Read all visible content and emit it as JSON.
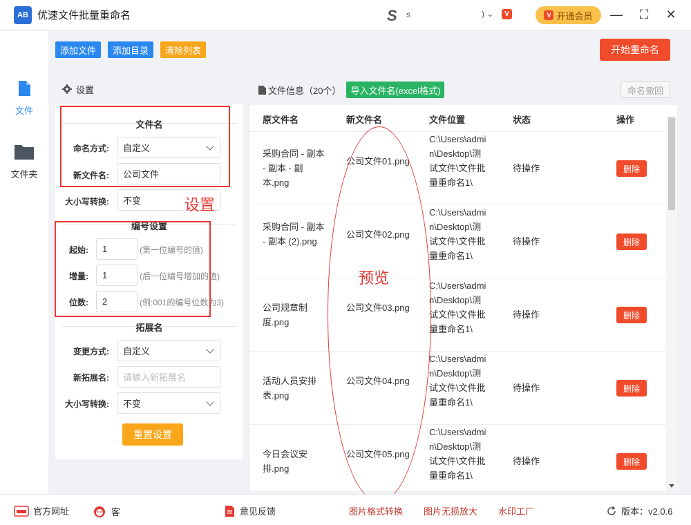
{
  "titlebar": {
    "app_title": "优速文件批量重命名",
    "logo_text": "AB",
    "user_s": "S",
    "user_name": "s",
    "user_arrow": ") ⌄",
    "vip_small": "V",
    "vip_label": "开通会员",
    "minimize": "—",
    "maximize": "⛶",
    "close": "✕"
  },
  "nav": {
    "files": "文件",
    "folders": "文件夹"
  },
  "toolbar": {
    "add_file": "添加文件",
    "add_dir": "添加目录",
    "clear_list": "清除列表",
    "start": "开始重命名"
  },
  "settings": {
    "header": "设置",
    "filename_section": "文件名",
    "naming_mode_label": "命名方式:",
    "naming_mode_value": "自定义",
    "new_name_label": "新文件名:",
    "new_name_value": "公司文件",
    "case_label": "大小写转换:",
    "case_value": "不变",
    "number_section": "编号设置",
    "start_label": "起始:",
    "start_value": "1",
    "start_hint": "(第一位编号的值)",
    "step_label": "增量:",
    "step_value": "1",
    "step_hint": "(后一位编号增加的值)",
    "digits_label": "位数:",
    "digits_value": "2",
    "digits_hint": "(例:001的编号位数为3)",
    "ext_section": "拓展名",
    "change_mode_label": "变更方式:",
    "change_mode_value": "自定义",
    "new_ext_label": "新拓展名:",
    "new_ext_placeholder": "请输入新拓展名",
    "ext_case_label": "大小写转换:",
    "ext_case_value": "不变",
    "reset": "重置设置"
  },
  "annotations": {
    "settings": "设置",
    "preview": "预览"
  },
  "filepanel": {
    "title": "文件信息（20个）",
    "import": "导入文件名(excel格式)",
    "undo": "命名撤回",
    "columns": [
      "原文件名",
      "新文件名",
      "文件位置",
      "状态",
      "操作"
    ],
    "rows": [
      {
        "orig": "采购合同 - 副本 - 副本 - 副本.png",
        "new": "公司文件01.png",
        "loc": "C:\\Users\\admin\\Desktop\\测试文件\\文件批量重命名1\\",
        "status": "待操作",
        "action": "删除"
      },
      {
        "orig": "采购合同 - 副本 - 副本 (2).png",
        "new": "公司文件02.png",
        "loc": "C:\\Users\\admin\\Desktop\\测试文件\\文件批量重命名1\\",
        "status": "待操作",
        "action": "删除"
      },
      {
        "orig": "公司规章制度.png",
        "new": "公司文件03.png",
        "loc": "C:\\Users\\admin\\Desktop\\测试文件\\文件批量重命名1\\",
        "status": "待操作",
        "action": "删除"
      },
      {
        "orig": "活动人员安排表.png",
        "new": "公司文件04.png",
        "loc": "C:\\Users\\admin\\Desktop\\测试文件\\文件批量重命名1\\",
        "status": "待操作",
        "action": "删除"
      },
      {
        "orig": "今日会议安排.png",
        "new": "公司文件05.png",
        "loc": "C:\\Users\\admin\\Desktop\\测试文件\\文件批量重命名1\\",
        "status": "待操作",
        "action": "删除"
      }
    ]
  },
  "footer": {
    "website": "官方网址",
    "service": "客",
    "feedback": "意见反馈",
    "format_convert": "图片格式转换",
    "lossless": "图片无损放大",
    "watermark": "水印工厂",
    "version": "版本：v2.0.6"
  },
  "colors": {
    "primary_blue": "#2b88f0",
    "orange": "#f9a61a",
    "red": "#f04b2a",
    "green": "#28b463"
  }
}
